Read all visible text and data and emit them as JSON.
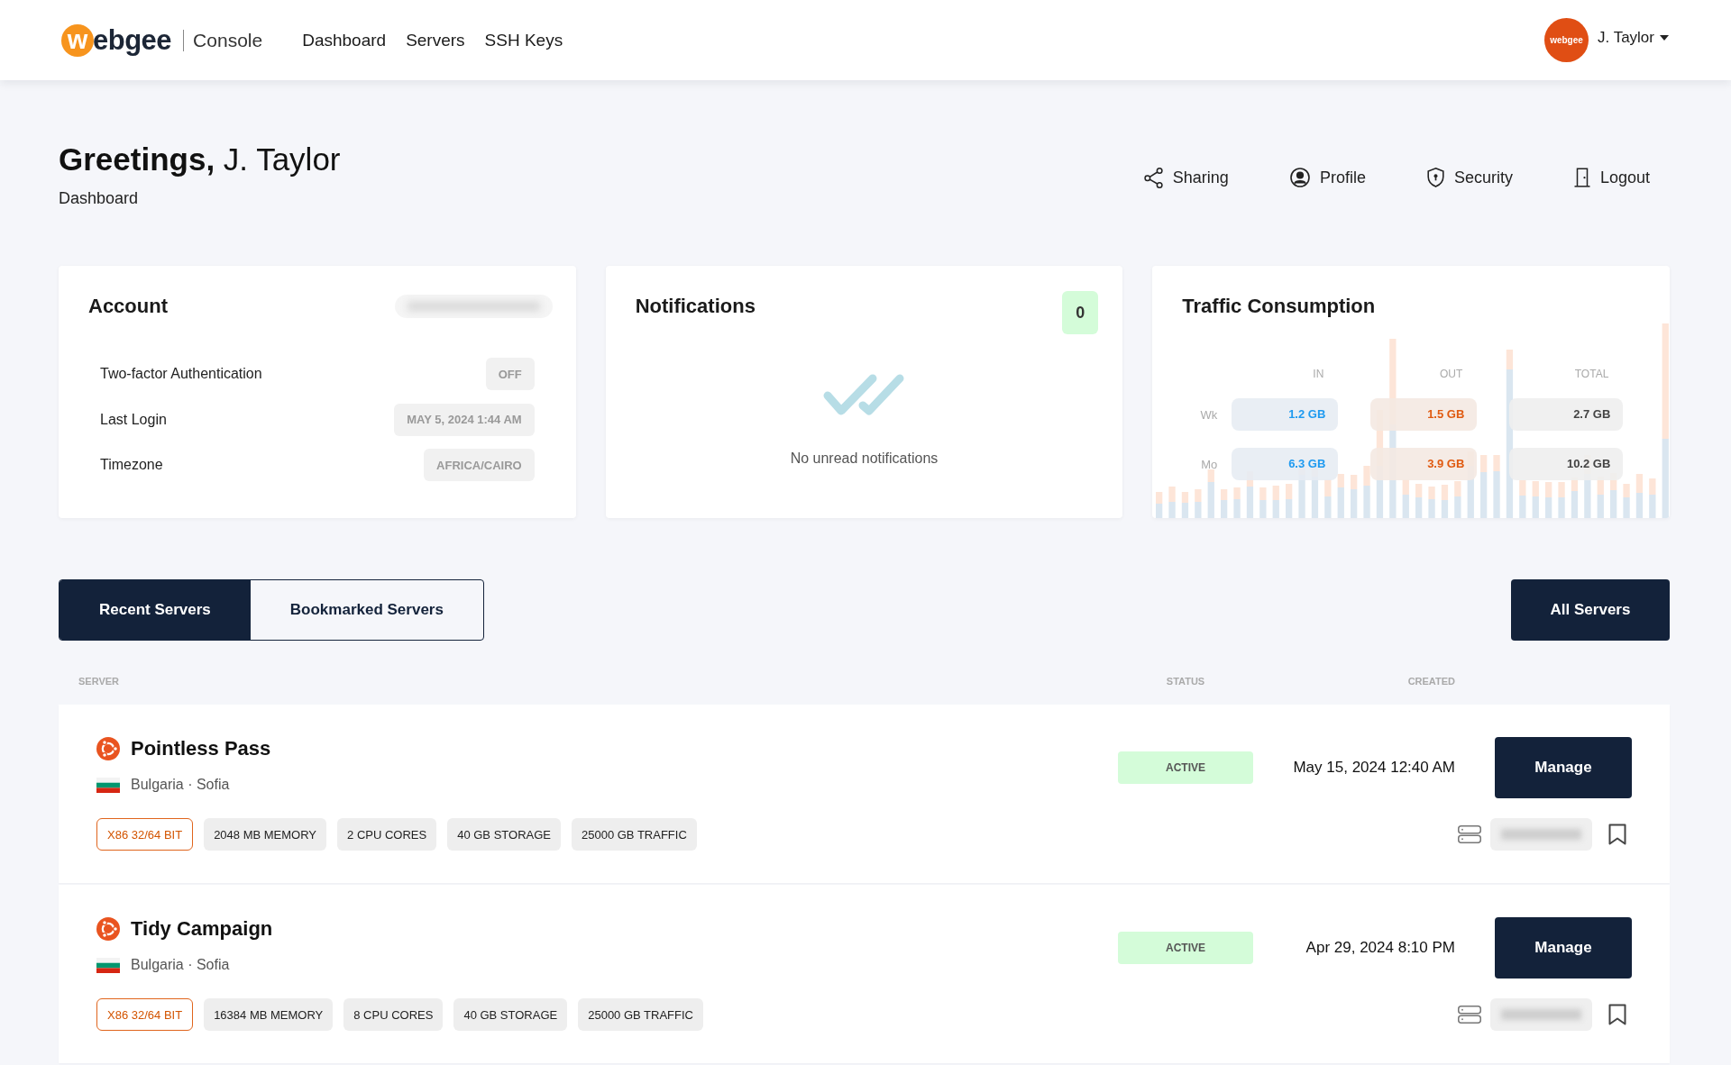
{
  "header": {
    "logo": "webgee",
    "product": "Console",
    "nav": [
      {
        "label": "Dashboard"
      },
      {
        "label": "Servers"
      },
      {
        "label": "SSH Keys"
      }
    ],
    "user": {
      "avatar_text": "webgee",
      "name": "J. Taylor"
    }
  },
  "page": {
    "greeting": "**Greetings,** J. Taylor",
    "subtitle": "Dashboard",
    "actions": [
      {
        "kind": "share",
        "label": "Sharing"
      },
      {
        "kind": "profile",
        "label": "Profile"
      },
      {
        "kind": "security",
        "label": "Security"
      },
      {
        "kind": "logout",
        "label": "Logout"
      }
    ]
  },
  "account": {
    "title": "Account",
    "rows": [
      {
        "label": "Two-factor Authentication",
        "value": "OFF"
      },
      {
        "label": "Last Login",
        "value": "MAY 5, 2024 1:44 AM"
      },
      {
        "label": "Timezone",
        "value": "AFRICA/CAIRO"
      }
    ]
  },
  "notifications": {
    "title": "Notifications",
    "count": "0",
    "empty_message": "No unread notifications"
  },
  "traffic": {
    "title": "Traffic Consumption",
    "columns": [
      {
        "kind": "in",
        "label": "IN"
      },
      {
        "kind": "out",
        "label": "OUT"
      },
      {
        "kind": "total",
        "label": "TOTAL"
      }
    ],
    "rows": [
      {
        "label": "Wk",
        "values": [
          "1.2 GB",
          "1.5 GB",
          "2.7 GB"
        ]
      },
      {
        "label": "Mo",
        "values": [
          "6.3 GB",
          "3.9 GB",
          "10.2 GB"
        ]
      }
    ]
  },
  "server_tabs": [
    {
      "label": "Recent Servers",
      "selected": true
    },
    {
      "label": "Bookmarked Servers",
      "selected": false
    }
  ],
  "all_servers_button": "All Servers",
  "table": {
    "columns": [
      "SERVER",
      "STATUS",
      "CREATED"
    ],
    "rows": [
      {
        "name": "Pointless Pass",
        "location": "Bulgaria · Sofia",
        "tags": [
          {
            "kind": "arch",
            "label": "X86 32/64 BIT"
          },
          {
            "kind": "spec",
            "label": "2048 MB MEMORY"
          },
          {
            "kind": "spec",
            "label": "2 CPU CORES"
          },
          {
            "kind": "spec",
            "label": "40 GB STORAGE"
          },
          {
            "kind": "spec",
            "label": "25000 GB TRAFFIC"
          }
        ],
        "status": "ACTIVE",
        "created": "May 15, 2024 12:40 AM",
        "action": "Manage",
        "bookmarked": false
      },
      {
        "name": "Tidy Campaign",
        "location": "Bulgaria · Sofia",
        "tags": [
          {
            "kind": "arch",
            "label": "X86 32/64 BIT"
          },
          {
            "kind": "spec",
            "label": "16384 MB MEMORY"
          },
          {
            "kind": "spec",
            "label": "8 CPU CORES"
          },
          {
            "kind": "spec",
            "label": "40 GB STORAGE"
          },
          {
            "kind": "spec",
            "label": "25000 GB TRAFFIC"
          }
        ],
        "status": "ACTIVE",
        "created": "Apr 29, 2024 8:10 PM",
        "action": "Manage",
        "bookmarked": false
      }
    ]
  }
}
